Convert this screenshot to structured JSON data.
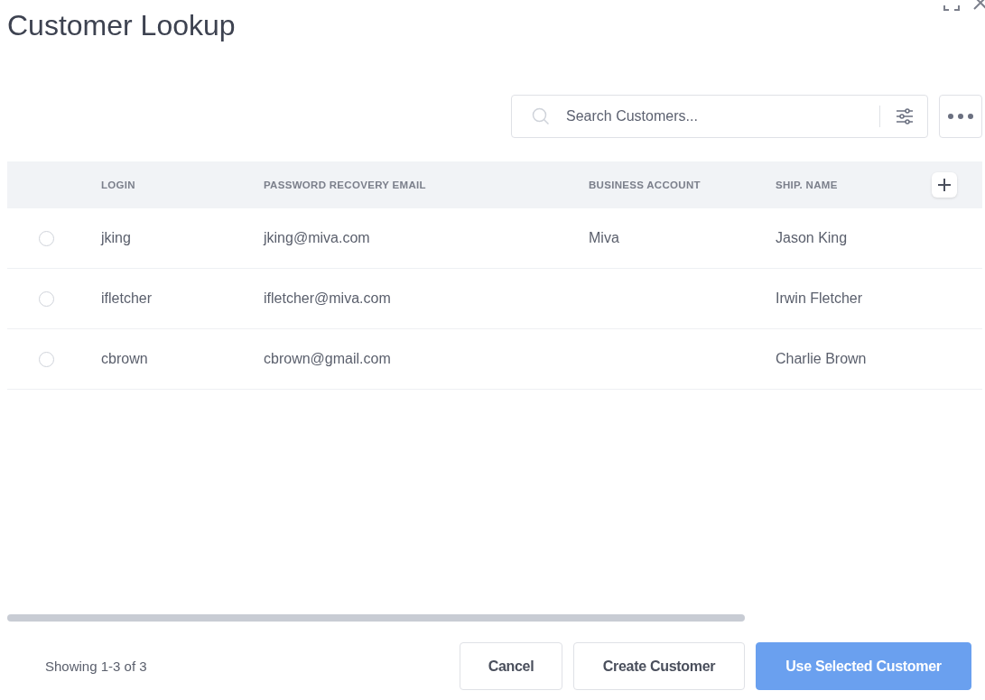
{
  "window": {
    "title": "Customer Lookup"
  },
  "search": {
    "placeholder": "Search Customers..."
  },
  "table": {
    "columns": [
      "LOGIN",
      "PASSWORD RECOVERY EMAIL",
      "BUSINESS ACCOUNT",
      "SHIP. NAME"
    ],
    "rows": [
      {
        "selected": false,
        "cells": [
          "jking",
          "jking@miva.com",
          "Miva",
          "Jason King"
        ]
      },
      {
        "selected": false,
        "cells": [
          "ifletcher",
          "ifletcher@miva.com",
          "",
          "Irwin Fletcher"
        ]
      },
      {
        "selected": false,
        "cells": [
          "cbrown",
          "cbrown@gmail.com",
          "",
          "Charlie Brown"
        ]
      }
    ]
  },
  "status_bar": {
    "text": "Showing 1-3 of 3"
  },
  "buttons": [
    {
      "label": "Cancel",
      "kind": "secondary",
      "disabled": false
    },
    {
      "label": "Create Customer",
      "kind": "secondary",
      "disabled": false
    },
    {
      "label": "Use Selected Customer",
      "kind": "primary",
      "disabled": true
    }
  ]
}
